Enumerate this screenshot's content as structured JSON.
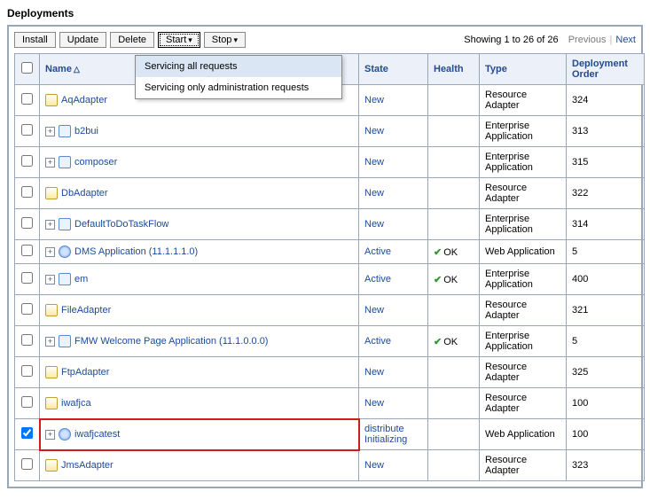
{
  "page_title": "Deployments",
  "toolbar": {
    "install": "Install",
    "update": "Update",
    "delete": "Delete",
    "start": "Start",
    "stop": "Stop"
  },
  "start_menu": {
    "item1": "Servicing all requests",
    "item2": "Servicing only administration requests"
  },
  "pager": {
    "summary": "Showing 1 to 26 of 26",
    "prev": "Previous",
    "next": "Next"
  },
  "columns": {
    "name": "Name",
    "state": "State",
    "health": "Health",
    "type": "Type",
    "order": "Deployment Order"
  },
  "health_ok": "OK",
  "rows": [
    {
      "checked": false,
      "expandable": false,
      "iconType": "res",
      "name": "AqAdapter",
      "state": "New",
      "health": "",
      "type": "Resource Adapter",
      "order": "324"
    },
    {
      "checked": false,
      "expandable": true,
      "iconType": "ent",
      "name": "b2bui",
      "state": "New",
      "health": "",
      "type": "Enterprise Application",
      "order": "313"
    },
    {
      "checked": false,
      "expandable": true,
      "iconType": "ent",
      "name": "composer",
      "state": "New",
      "health": "",
      "type": "Enterprise Application",
      "order": "315"
    },
    {
      "checked": false,
      "expandable": false,
      "iconType": "res",
      "name": "DbAdapter",
      "state": "New",
      "health": "",
      "type": "Resource Adapter",
      "order": "322"
    },
    {
      "checked": false,
      "expandable": true,
      "iconType": "ent",
      "name": "DefaultToDoTaskFlow",
      "state": "New",
      "health": "",
      "type": "Enterprise Application",
      "order": "314"
    },
    {
      "checked": false,
      "expandable": true,
      "iconType": "web",
      "name": "DMS Application (11.1.1.1.0)",
      "state": "Active",
      "health": "ok",
      "type": "Web Application",
      "order": "5"
    },
    {
      "checked": false,
      "expandable": true,
      "iconType": "ent",
      "name": "em",
      "state": "Active",
      "health": "ok",
      "type": "Enterprise Application",
      "order": "400"
    },
    {
      "checked": false,
      "expandable": false,
      "iconType": "res",
      "name": "FileAdapter",
      "state": "New",
      "health": "",
      "type": "Resource Adapter",
      "order": "321"
    },
    {
      "checked": false,
      "expandable": true,
      "iconType": "ent",
      "name": "FMW Welcome Page Application (11.1.0.0.0)",
      "state": "Active",
      "health": "ok",
      "type": "Enterprise Application",
      "order": "5"
    },
    {
      "checked": false,
      "expandable": false,
      "iconType": "res",
      "name": "FtpAdapter",
      "state": "New",
      "health": "",
      "type": "Resource Adapter",
      "order": "325"
    },
    {
      "checked": false,
      "expandable": false,
      "iconType": "res",
      "name": "iwafjca",
      "state": "New",
      "health": "",
      "type": "Resource Adapter",
      "order": "100"
    },
    {
      "checked": true,
      "expandable": true,
      "iconType": "web",
      "name": "iwafjcatest",
      "state": "distribute Initializing",
      "health": "",
      "type": "Web Application",
      "order": "100",
      "highlight": true
    },
    {
      "checked": false,
      "expandable": false,
      "iconType": "res",
      "name": "JmsAdapter",
      "state": "New",
      "health": "",
      "type": "Resource Adapter",
      "order": "323"
    }
  ]
}
